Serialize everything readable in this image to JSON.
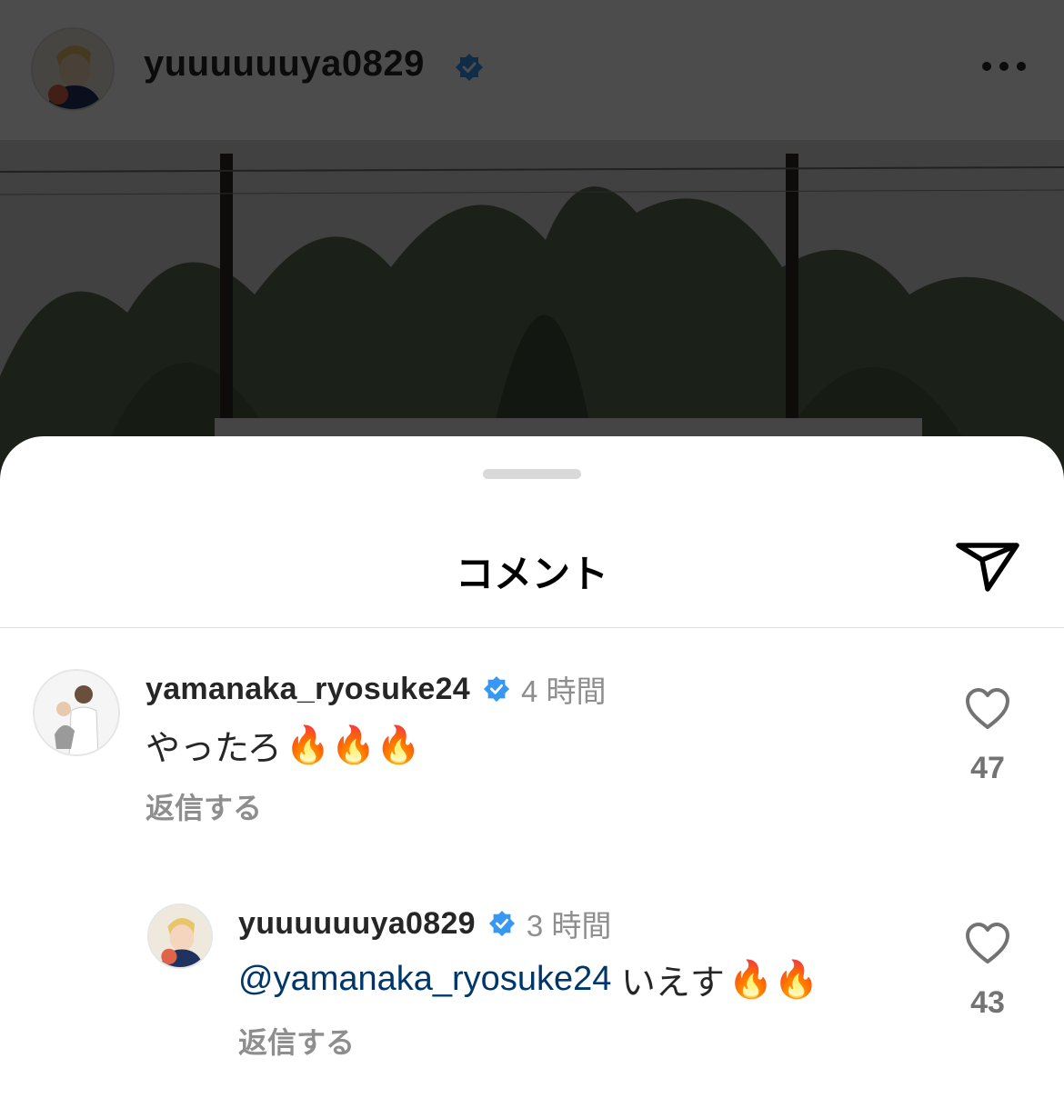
{
  "post": {
    "username": "yuuuuuuya0829",
    "verified_icon": "verified-badge-icon",
    "more_icon": "more-options-icon"
  },
  "sheet": {
    "title": "コメント",
    "share_icon": "send-icon"
  },
  "comments": [
    {
      "username": "yamanaka_ryosuke24",
      "time": "4 時間",
      "text": "やったろ",
      "emoji": "🔥🔥🔥",
      "reply_label": "返信する",
      "likes": "47"
    },
    {
      "username": "yuuuuuuya0829",
      "time": "3 時間",
      "mention": "@yamanaka_ryosuke24",
      "text": " いえす",
      "emoji": "🔥🔥",
      "reply_label": "返信する",
      "likes": "43"
    }
  ],
  "colors": {
    "verified": "#3897f0",
    "mention": "#00376b",
    "secondary_text": "#8e8e8e"
  }
}
